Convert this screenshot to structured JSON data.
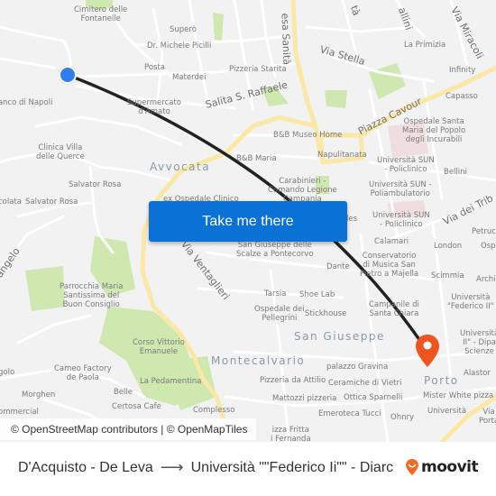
{
  "map": {
    "colors": {
      "background": "#f2f2f2",
      "road": "#ffffff",
      "major_road": "#fbe7a6",
      "park": "#cfe8b0",
      "route_line": "#222222",
      "origin_marker": "#2e7ef0",
      "destination_marker": "#f0541e",
      "button": "#0a72d6"
    },
    "poi_labels": [
      {
        "id": "cimitero",
        "text": "Cimitero delle\nFontanelle"
      },
      {
        "id": "supero",
        "text": "Superò"
      },
      {
        "id": "picilli",
        "text": "Dr. Michele Picilli"
      },
      {
        "id": "posta",
        "text": "Posta"
      },
      {
        "id": "materdei",
        "text": "Materdei"
      },
      {
        "id": "pizzeria-starita",
        "text": "Pizzeria Starita"
      },
      {
        "id": "supermercato",
        "text": "Supermercato\nd'Amato"
      },
      {
        "id": "banco-napoli",
        "text": "Banco di Napoli"
      },
      {
        "id": "la-primizia",
        "text": "La Primizia"
      },
      {
        "id": "infinity",
        "text": "Infinity"
      },
      {
        "id": "capasso",
        "text": "Capasso"
      },
      {
        "id": "ospedale-incurabili",
        "text": "Ospedale Santa\nMaria del Popolo\ndegli Incurabili"
      },
      {
        "id": "bb-museo",
        "text": "B&B Museo Home"
      },
      {
        "id": "bb-maria",
        "text": "B&B Maria"
      },
      {
        "id": "napulitanata",
        "text": "Napulitanata"
      },
      {
        "id": "sun-policlinico-1",
        "text": "Università SUN\n- Policlinico"
      },
      {
        "id": "bellini",
        "text": "Bellini"
      },
      {
        "id": "carabinieri",
        "text": "Carabinieri -\nComando Legione\nCampania"
      },
      {
        "id": "sun-poliamb",
        "text": "Università SUN -\nPoliambulatorio"
      },
      {
        "id": "sun-policlinico-2",
        "text": "Università SUN\n- Policlinico"
      },
      {
        "id": "clinica-villa",
        "text": "Clinica Villa\ndelle Querce"
      },
      {
        "id": "salvator-rosa-1",
        "text": "Salvator Rosa"
      },
      {
        "id": "salvator-rosa-2",
        "text": "Salvator Rosa"
      },
      {
        "id": "colata",
        "text": "colata"
      },
      {
        "id": "ex-ospedale",
        "text": "ex Ospedale Clinico"
      },
      {
        "id": "petruc",
        "text": "Petruc"
      },
      {
        "id": "san-giuseppe-scalze",
        "text": "San Giuseppe delle\nScalze a Pontecorvo"
      },
      {
        "id": "calamari",
        "text": "Calamari"
      },
      {
        "id": "london",
        "text": "London"
      },
      {
        "id": "osp",
        "text": "Osp"
      },
      {
        "id": "conservatorio",
        "text": "Conservatorio\ndi Musica San\nPietro a Majella"
      },
      {
        "id": "dante",
        "text": "Dante"
      },
      {
        "id": "des",
        "text": "des"
      },
      {
        "id": "scimmia",
        "text": "Scimmia"
      },
      {
        "id": "archi",
        "text": "Archi"
      },
      {
        "id": "parrocchia",
        "text": "Parrocchia Maria\nSantissima del\nBuon Consiglio"
      },
      {
        "id": "tarsia",
        "text": "Tarsia"
      },
      {
        "id": "shoe-lab",
        "text": "Shoe Lab"
      },
      {
        "id": "ospedale-pellegrini",
        "text": "Ospedale dei\nPellegrini"
      },
      {
        "id": "stickhouse",
        "text": "Stickhouse"
      },
      {
        "id": "campanile",
        "text": "Campanile di\nSanta Chiara"
      },
      {
        "id": "univ-federico",
        "text": "Università\n\"Federico II\""
      },
      {
        "id": "univ-dipa",
        "text": "Università\nII\" - Dipa\nScienze"
      },
      {
        "id": "corso-vittorio",
        "text": "Corso Vittorio\nEmanuele"
      },
      {
        "id": "cameo",
        "text": "Cameo Factory\nde Paola"
      },
      {
        "id": "la-pedamentina",
        "text": "La Pedamentina"
      },
      {
        "id": "belle",
        "text": "Belle"
      },
      {
        "id": "certosa",
        "text": "Certosa Cafe"
      },
      {
        "id": "complesso",
        "text": "Complesso"
      },
      {
        "id": "golo",
        "text": "golo"
      },
      {
        "id": "morghen",
        "text": "Morghen"
      },
      {
        "id": "commercial",
        "text": "ommercial"
      },
      {
        "id": "palazzo-gravina",
        "text": "palazzo Gravina"
      },
      {
        "id": "pizzeria-attilio",
        "text": "Pizzeria da Attilio"
      },
      {
        "id": "ceramiche",
        "text": "Ceramiche di Vietri"
      },
      {
        "id": "alastor",
        "text": "Alastor"
      },
      {
        "id": "mattozzi",
        "text": "Mattozzi pizzeria"
      },
      {
        "id": "ottica",
        "text": "Ottica Sparnelli"
      },
      {
        "id": "mister-white",
        "text": "Mister White pizza"
      },
      {
        "id": "emeroteca",
        "text": "Emeroteca Tucci"
      },
      {
        "id": "ohnry",
        "text": "Ohnry"
      },
      {
        "id": "universita-bottom",
        "text": "Università"
      },
      {
        "id": "via-porta",
        "text": "Via\nPorta"
      },
      {
        "id": "pizza-fritta",
        "text": "izza Fritta\ni Fernanda"
      }
    ],
    "street_labels": [
      {
        "id": "salita-s-raffaele",
        "text": "Salita S. Raffaele"
      },
      {
        "id": "via-stella",
        "text": "Via Stella"
      },
      {
        "id": "piazza-cavour",
        "text": "Piazza Cavour"
      },
      {
        "id": "via-dei-tribunali",
        "text": "Via dei Trib"
      },
      {
        "id": "via-ventaglieri",
        "text": "Via Ventaglieri"
      },
      {
        "id": "sanita",
        "text": "esa Sanità"
      },
      {
        "id": "via-miracoli",
        "text": "Via Miracoli"
      },
      {
        "id": "gallini",
        "text": "allini"
      },
      {
        "id": "santa-top",
        "text": "tà"
      },
      {
        "id": "angelo",
        "text": "angelo"
      }
    ],
    "district_labels": [
      {
        "id": "avvocata",
        "text": "Avvocata"
      },
      {
        "id": "san-giuseppe",
        "text": "San Giuseppe"
      },
      {
        "id": "montecalvario",
        "text": "Montecalvario"
      },
      {
        "id": "porto",
        "text": "Porto"
      }
    ]
  },
  "markers": {
    "origin": {
      "name": "D'Acquisto - De Leva",
      "icon": "origin-dot-icon"
    },
    "destination": {
      "name": "Università \"\"Federico Ii\"\" - Diarc",
      "icon": "destination-pin-icon"
    }
  },
  "cta": {
    "label": "Take me there"
  },
  "attribution": {
    "text": "© OpenStreetMap contributors | © OpenMapTiles"
  },
  "footer": {
    "origin": "D'Acquisto - De Leva",
    "arrow_icon": "arrow-right-icon",
    "destination": "Università \"\"Federico Ii\"\" - Diarc",
    "brand": "moovit"
  }
}
